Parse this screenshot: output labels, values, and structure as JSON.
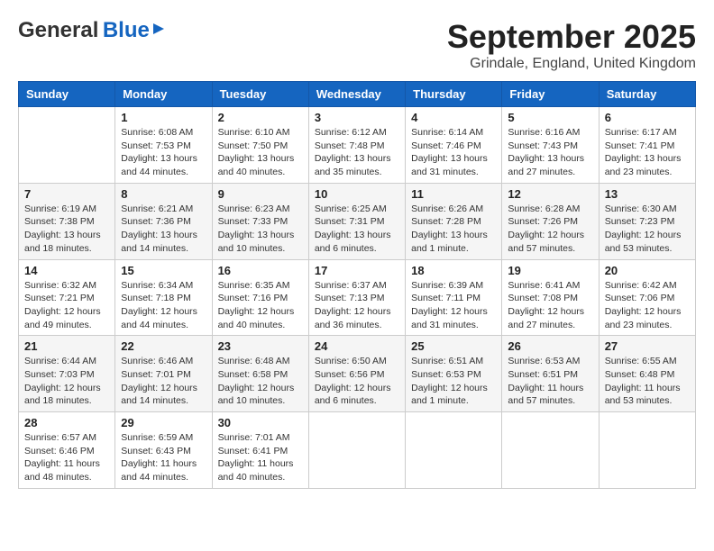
{
  "header": {
    "logo_general": "General",
    "logo_blue": "Blue",
    "month_title": "September 2025",
    "subtitle": "Grindale, England, United Kingdom"
  },
  "days_of_week": [
    "Sunday",
    "Monday",
    "Tuesday",
    "Wednesday",
    "Thursday",
    "Friday",
    "Saturday"
  ],
  "weeks": [
    [
      {
        "day": "",
        "sunrise": "",
        "sunset": "",
        "daylight": ""
      },
      {
        "day": "1",
        "sunrise": "Sunrise: 6:08 AM",
        "sunset": "Sunset: 7:53 PM",
        "daylight": "Daylight: 13 hours and 44 minutes."
      },
      {
        "day": "2",
        "sunrise": "Sunrise: 6:10 AM",
        "sunset": "Sunset: 7:50 PM",
        "daylight": "Daylight: 13 hours and 40 minutes."
      },
      {
        "day": "3",
        "sunrise": "Sunrise: 6:12 AM",
        "sunset": "Sunset: 7:48 PM",
        "daylight": "Daylight: 13 hours and 35 minutes."
      },
      {
        "day": "4",
        "sunrise": "Sunrise: 6:14 AM",
        "sunset": "Sunset: 7:46 PM",
        "daylight": "Daylight: 13 hours and 31 minutes."
      },
      {
        "day": "5",
        "sunrise": "Sunrise: 6:16 AM",
        "sunset": "Sunset: 7:43 PM",
        "daylight": "Daylight: 13 hours and 27 minutes."
      },
      {
        "day": "6",
        "sunrise": "Sunrise: 6:17 AM",
        "sunset": "Sunset: 7:41 PM",
        "daylight": "Daylight: 13 hours and 23 minutes."
      }
    ],
    [
      {
        "day": "7",
        "sunrise": "Sunrise: 6:19 AM",
        "sunset": "Sunset: 7:38 PM",
        "daylight": "Daylight: 13 hours and 18 minutes."
      },
      {
        "day": "8",
        "sunrise": "Sunrise: 6:21 AM",
        "sunset": "Sunset: 7:36 PM",
        "daylight": "Daylight: 13 hours and 14 minutes."
      },
      {
        "day": "9",
        "sunrise": "Sunrise: 6:23 AM",
        "sunset": "Sunset: 7:33 PM",
        "daylight": "Daylight: 13 hours and 10 minutes."
      },
      {
        "day": "10",
        "sunrise": "Sunrise: 6:25 AM",
        "sunset": "Sunset: 7:31 PM",
        "daylight": "Daylight: 13 hours and 6 minutes."
      },
      {
        "day": "11",
        "sunrise": "Sunrise: 6:26 AM",
        "sunset": "Sunset: 7:28 PM",
        "daylight": "Daylight: 13 hours and 1 minute."
      },
      {
        "day": "12",
        "sunrise": "Sunrise: 6:28 AM",
        "sunset": "Sunset: 7:26 PM",
        "daylight": "Daylight: 12 hours and 57 minutes."
      },
      {
        "day": "13",
        "sunrise": "Sunrise: 6:30 AM",
        "sunset": "Sunset: 7:23 PM",
        "daylight": "Daylight: 12 hours and 53 minutes."
      }
    ],
    [
      {
        "day": "14",
        "sunrise": "Sunrise: 6:32 AM",
        "sunset": "Sunset: 7:21 PM",
        "daylight": "Daylight: 12 hours and 49 minutes."
      },
      {
        "day": "15",
        "sunrise": "Sunrise: 6:34 AM",
        "sunset": "Sunset: 7:18 PM",
        "daylight": "Daylight: 12 hours and 44 minutes."
      },
      {
        "day": "16",
        "sunrise": "Sunrise: 6:35 AM",
        "sunset": "Sunset: 7:16 PM",
        "daylight": "Daylight: 12 hours and 40 minutes."
      },
      {
        "day": "17",
        "sunrise": "Sunrise: 6:37 AM",
        "sunset": "Sunset: 7:13 PM",
        "daylight": "Daylight: 12 hours and 36 minutes."
      },
      {
        "day": "18",
        "sunrise": "Sunrise: 6:39 AM",
        "sunset": "Sunset: 7:11 PM",
        "daylight": "Daylight: 12 hours and 31 minutes."
      },
      {
        "day": "19",
        "sunrise": "Sunrise: 6:41 AM",
        "sunset": "Sunset: 7:08 PM",
        "daylight": "Daylight: 12 hours and 27 minutes."
      },
      {
        "day": "20",
        "sunrise": "Sunrise: 6:42 AM",
        "sunset": "Sunset: 7:06 PM",
        "daylight": "Daylight: 12 hours and 23 minutes."
      }
    ],
    [
      {
        "day": "21",
        "sunrise": "Sunrise: 6:44 AM",
        "sunset": "Sunset: 7:03 PM",
        "daylight": "Daylight: 12 hours and 18 minutes."
      },
      {
        "day": "22",
        "sunrise": "Sunrise: 6:46 AM",
        "sunset": "Sunset: 7:01 PM",
        "daylight": "Daylight: 12 hours and 14 minutes."
      },
      {
        "day": "23",
        "sunrise": "Sunrise: 6:48 AM",
        "sunset": "Sunset: 6:58 PM",
        "daylight": "Daylight: 12 hours and 10 minutes."
      },
      {
        "day": "24",
        "sunrise": "Sunrise: 6:50 AM",
        "sunset": "Sunset: 6:56 PM",
        "daylight": "Daylight: 12 hours and 6 minutes."
      },
      {
        "day": "25",
        "sunrise": "Sunrise: 6:51 AM",
        "sunset": "Sunset: 6:53 PM",
        "daylight": "Daylight: 12 hours and 1 minute."
      },
      {
        "day": "26",
        "sunrise": "Sunrise: 6:53 AM",
        "sunset": "Sunset: 6:51 PM",
        "daylight": "Daylight: 11 hours and 57 minutes."
      },
      {
        "day": "27",
        "sunrise": "Sunrise: 6:55 AM",
        "sunset": "Sunset: 6:48 PM",
        "daylight": "Daylight: 11 hours and 53 minutes."
      }
    ],
    [
      {
        "day": "28",
        "sunrise": "Sunrise: 6:57 AM",
        "sunset": "Sunset: 6:46 PM",
        "daylight": "Daylight: 11 hours and 48 minutes."
      },
      {
        "day": "29",
        "sunrise": "Sunrise: 6:59 AM",
        "sunset": "Sunset: 6:43 PM",
        "daylight": "Daylight: 11 hours and 44 minutes."
      },
      {
        "day": "30",
        "sunrise": "Sunrise: 7:01 AM",
        "sunset": "Sunset: 6:41 PM",
        "daylight": "Daylight: 11 hours and 40 minutes."
      },
      {
        "day": "",
        "sunrise": "",
        "sunset": "",
        "daylight": ""
      },
      {
        "day": "",
        "sunrise": "",
        "sunset": "",
        "daylight": ""
      },
      {
        "day": "",
        "sunrise": "",
        "sunset": "",
        "daylight": ""
      },
      {
        "day": "",
        "sunrise": "",
        "sunset": "",
        "daylight": ""
      }
    ]
  ]
}
